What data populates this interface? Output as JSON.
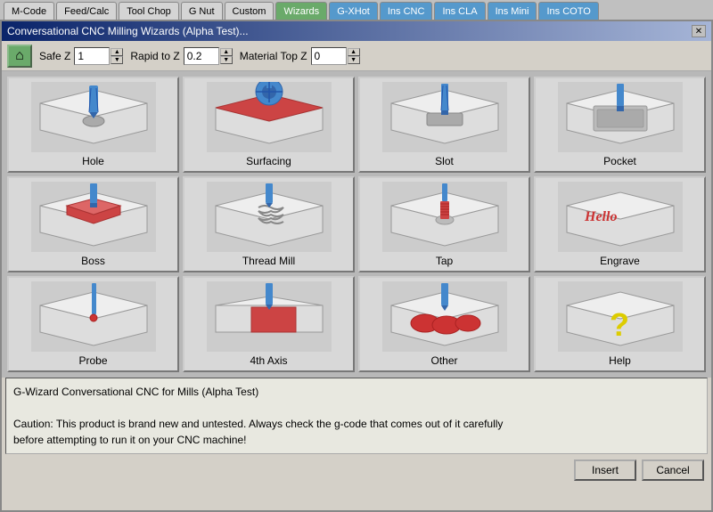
{
  "tabs": [
    {
      "id": "mcode",
      "label": "M-Code",
      "active": false
    },
    {
      "id": "feedcalc",
      "label": "Feed/Calc",
      "active": false
    },
    {
      "id": "toolchop",
      "label": "Tool Chop",
      "active": false
    },
    {
      "id": "gnat",
      "label": "G Nut",
      "active": false
    },
    {
      "id": "custom",
      "label": "Custom",
      "active": false
    },
    {
      "id": "wizards",
      "label": "Wizards",
      "active": true
    },
    {
      "id": "gxhot",
      "label": "G-XHot",
      "active": false
    },
    {
      "id": "inscnc",
      "label": "Ins CNC",
      "active": false
    },
    {
      "id": "inscla",
      "label": "Ins CLA",
      "active": false
    },
    {
      "id": "insmini",
      "label": "Ins Mini",
      "active": false
    },
    {
      "id": "inscoto",
      "label": "Ins COTO",
      "active": false
    }
  ],
  "dialog": {
    "title": "Conversational CNC Milling Wizards (Alpha Test)...",
    "close_label": "✕"
  },
  "toolbar": {
    "home_icon": "⌂",
    "safe_z_label": "Safe Z",
    "safe_z_value": "1",
    "rapid_z_label": "Rapid to Z",
    "rapid_z_value": "0.2",
    "material_top_z_label": "Material Top Z",
    "material_top_z_value": "0"
  },
  "wizards": [
    {
      "id": "hole",
      "label": "Hole"
    },
    {
      "id": "surfacing",
      "label": "Surfacing"
    },
    {
      "id": "slot",
      "label": "Slot"
    },
    {
      "id": "pocket",
      "label": "Pocket"
    },
    {
      "id": "boss",
      "label": "Boss"
    },
    {
      "id": "thread-mill",
      "label": "Thread Mill"
    },
    {
      "id": "tap",
      "label": "Tap"
    },
    {
      "id": "engrave",
      "label": "Engrave"
    },
    {
      "id": "probe",
      "label": "Probe"
    },
    {
      "id": "4th-axis",
      "label": "4th Axis"
    },
    {
      "id": "other",
      "label": "Other"
    },
    {
      "id": "help",
      "label": "Help"
    }
  ],
  "bottom_text": {
    "line1": "G-Wizard Conversational CNC for Mills (Alpha Test)",
    "line2": "Caution: This product is brand new and untested.  Always check the g-code that comes out of it carefully",
    "line3": "before attempting to run it on your CNC machine!"
  },
  "footer": {
    "insert_label": "Insert",
    "cancel_label": "Cancel"
  }
}
